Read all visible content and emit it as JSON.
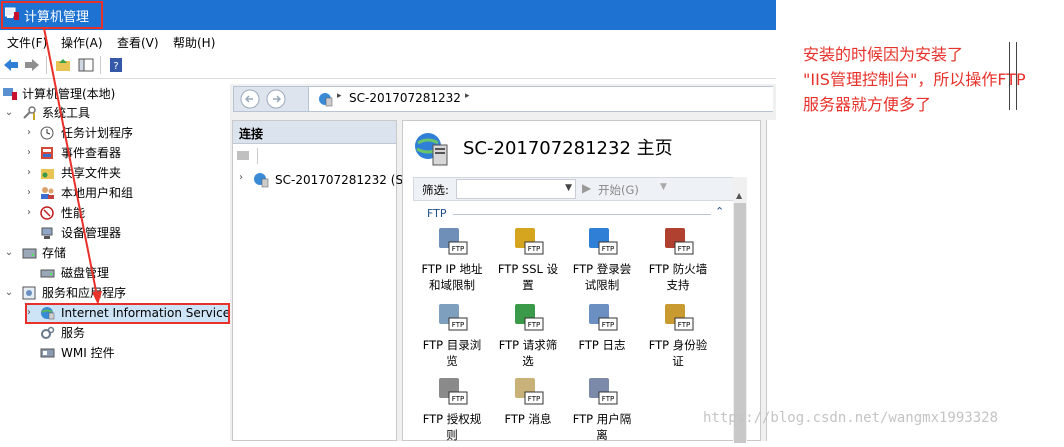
{
  "window": {
    "title": "计算机管理"
  },
  "menu": {
    "file": "文件(F)",
    "action": "操作(A)",
    "view": "查看(V)",
    "help": "帮助(H)"
  },
  "tree": {
    "root": "计算机管理(本地)",
    "system_tools": "系统工具",
    "task_scheduler": "任务计划程序",
    "event_viewer": "事件查看器",
    "shared_folders": "共享文件夹",
    "local_users": "本地用户和组",
    "performance": "性能",
    "device_manager": "设备管理器",
    "storage": "存储",
    "disk_management": "磁盘管理",
    "services_apps": "服务和应用程序",
    "iis": "Internet Information Service",
    "services": "服务",
    "wmi": "WMI 控件"
  },
  "iis": {
    "address_server": "SC-201707281232",
    "connections_header": "连接",
    "connection_node": "SC-201707281232 (S",
    "main_title": "SC-201707281232 主页",
    "filter_label": "筛选:",
    "start_label": "开始(G)",
    "group_label": "FTP",
    "features": [
      {
        "l1": "FTP IP 地址",
        "l2": "和域限制"
      },
      {
        "l1": "FTP SSL 设",
        "l2": "置"
      },
      {
        "l1": "FTP 登录尝",
        "l2": "试限制"
      },
      {
        "l1": "FTP 防火墙",
        "l2": "支持"
      },
      {
        "l1": "FTP 目录浏",
        "l2": "览"
      },
      {
        "l1": "FTP 请求筛",
        "l2": "选"
      },
      {
        "l1": "FTP 日志",
        "l2": ""
      },
      {
        "l1": "FTP 身份验",
        "l2": "证"
      },
      {
        "l1": "FTP 授权规",
        "l2": "则"
      },
      {
        "l1": "FTP 消息",
        "l2": ""
      },
      {
        "l1": "FTP 用户隔",
        "l2": "离"
      }
    ]
  },
  "annotation": {
    "line1": "安装的时候因为安装了",
    "line2": "\"IIS管理控制台\"，所以操作FTP",
    "line3": "服务器就方便多了"
  },
  "watermark": "https://blog.csdn.net/wangmx1993328",
  "colors": {
    "titlebar": "#1e73d2",
    "highlight": "#e8312a",
    "annotation": "#e8312a"
  }
}
